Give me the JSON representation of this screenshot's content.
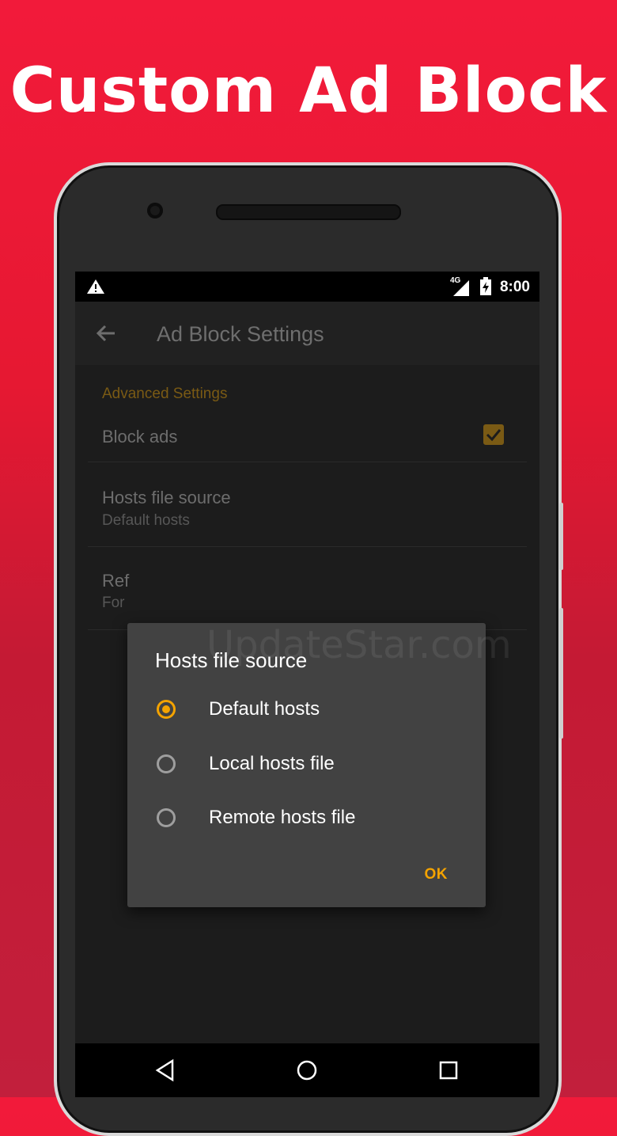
{
  "headline": "Custom Ad Block",
  "statusbar": {
    "network": "4G",
    "time": "8:00"
  },
  "appbar": {
    "title": "Ad Block Settings"
  },
  "settings": {
    "section": "Advanced Settings",
    "block_ads": {
      "title": "Block ads",
      "checked": true
    },
    "hosts_source": {
      "title": "Hosts file source",
      "summary": "Default hosts"
    },
    "refresh": {
      "title_partial": "Ref",
      "summary_partial": "For"
    }
  },
  "dialog": {
    "title": "Hosts file source",
    "options": [
      {
        "label": "Default hosts",
        "selected": true
      },
      {
        "label": "Local hosts file",
        "selected": false
      },
      {
        "label": "Remote hosts file",
        "selected": false
      }
    ],
    "ok_label": "OK"
  },
  "watermark": "UpdateStar.com",
  "colors": {
    "accent": "#f4a300",
    "background": "#e61832"
  }
}
